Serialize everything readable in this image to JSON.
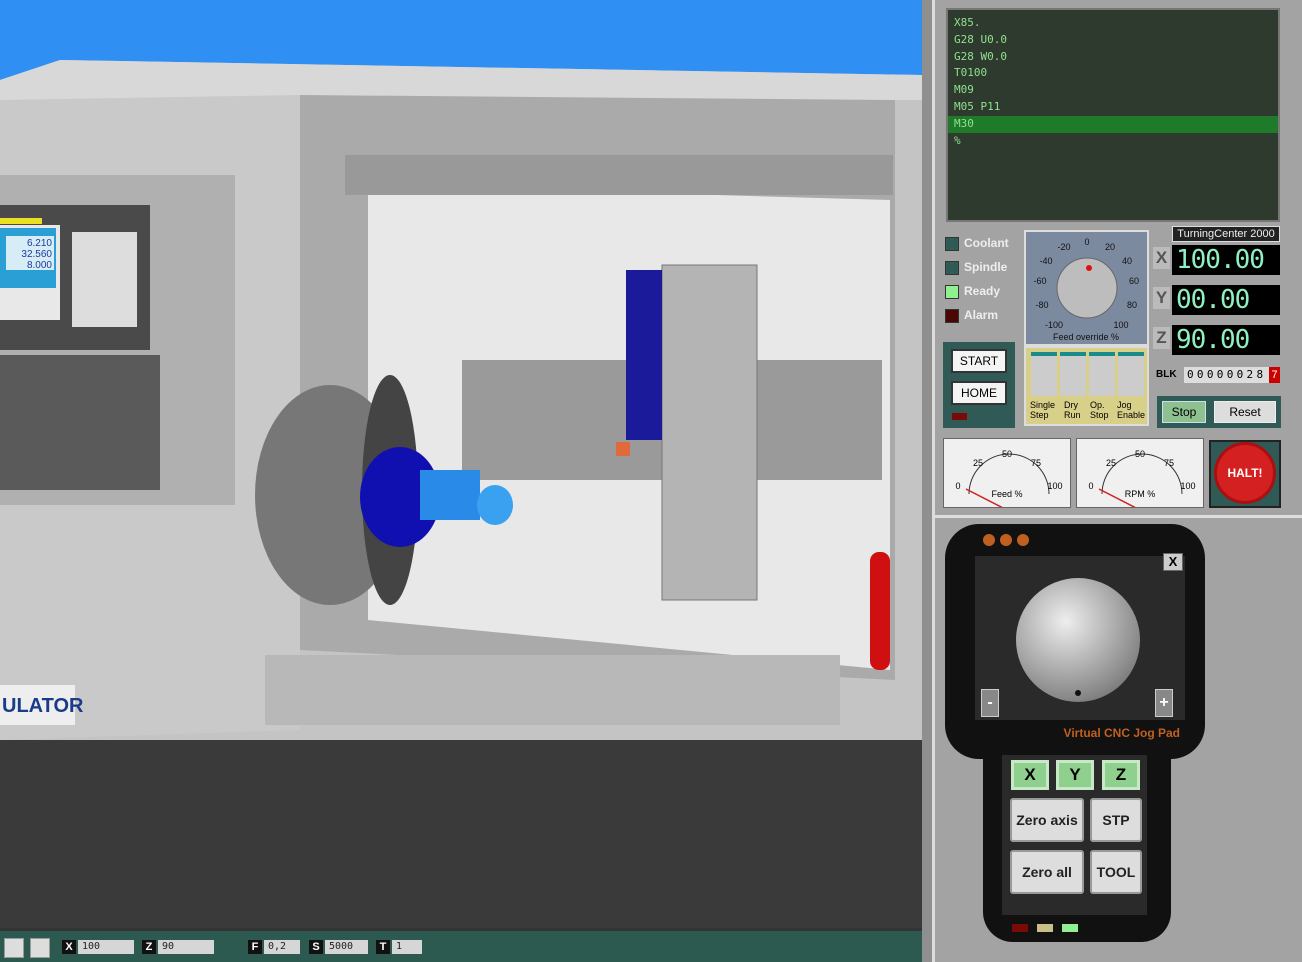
{
  "program": {
    "lines": [
      "X85.",
      "G28 U0.0",
      "G28 W0.0",
      "T0100",
      "M09",
      "M05 P11",
      "M30",
      "%"
    ],
    "highlighted_index": 6
  },
  "indicators": [
    {
      "label": "Coolant",
      "color": "#2f5a55"
    },
    {
      "label": "Spindle",
      "color": "#2f5a55"
    },
    {
      "label": "Ready",
      "color": "#90f090"
    },
    {
      "label": "Alarm",
      "color": "#4a0505"
    }
  ],
  "buttons": {
    "start": "START",
    "home": "HOME",
    "stop": "Stop",
    "reset": "Reset",
    "halt": "HALT!"
  },
  "feed_override": {
    "label": "Feed override %",
    "ticks": [
      "-100",
      "-80",
      "-60",
      "-40",
      "-20",
      "0",
      "20",
      "40",
      "60",
      "80",
      "100"
    ],
    "value": 0
  },
  "switches": [
    {
      "l1": "Single",
      "l2": "Step"
    },
    {
      "l1": "Dry",
      "l2": "Run"
    },
    {
      "l1": "Op.",
      "l2": "Stop"
    },
    {
      "l1": "Jog",
      "l2": "Enable"
    }
  ],
  "machine_name": "TurningCenter 2000",
  "dro": {
    "x_label": "X",
    "x": "100.00",
    "y_label": "Y",
    "y": "00.00",
    "z_label": "Z",
    "z": "90.00"
  },
  "blk": {
    "label": "BLK",
    "digits": "000000287",
    "last": "7"
  },
  "gauges": [
    {
      "label": "Feed %",
      "ticks": [
        "0",
        "25",
        "50",
        "75",
        "100"
      ]
    },
    {
      "label": "RPM %",
      "ticks": [
        "0",
        "25",
        "50",
        "75",
        "100"
      ]
    }
  ],
  "jogpad": {
    "title": "Virtual CNC Jog Pad",
    "close": "X",
    "minus": "-",
    "plus": "+",
    "axes": [
      "X",
      "Y",
      "Z"
    ],
    "zero_axis": "Zero axis",
    "stp": "STP",
    "zero_all": "Zero all",
    "tool": "TOOL"
  },
  "panel_screen": {
    "l1": "6.210",
    "l2": "32.560",
    "l3": "8.000"
  },
  "logo": "ULATOR",
  "statusbar": {
    "x_key": "X",
    "x": "100",
    "z_key": "Z",
    "z": "90",
    "f_key": "F",
    "f": "0,2",
    "s_key": "S",
    "s": "5000",
    "t_key": "T",
    "t": "1"
  }
}
